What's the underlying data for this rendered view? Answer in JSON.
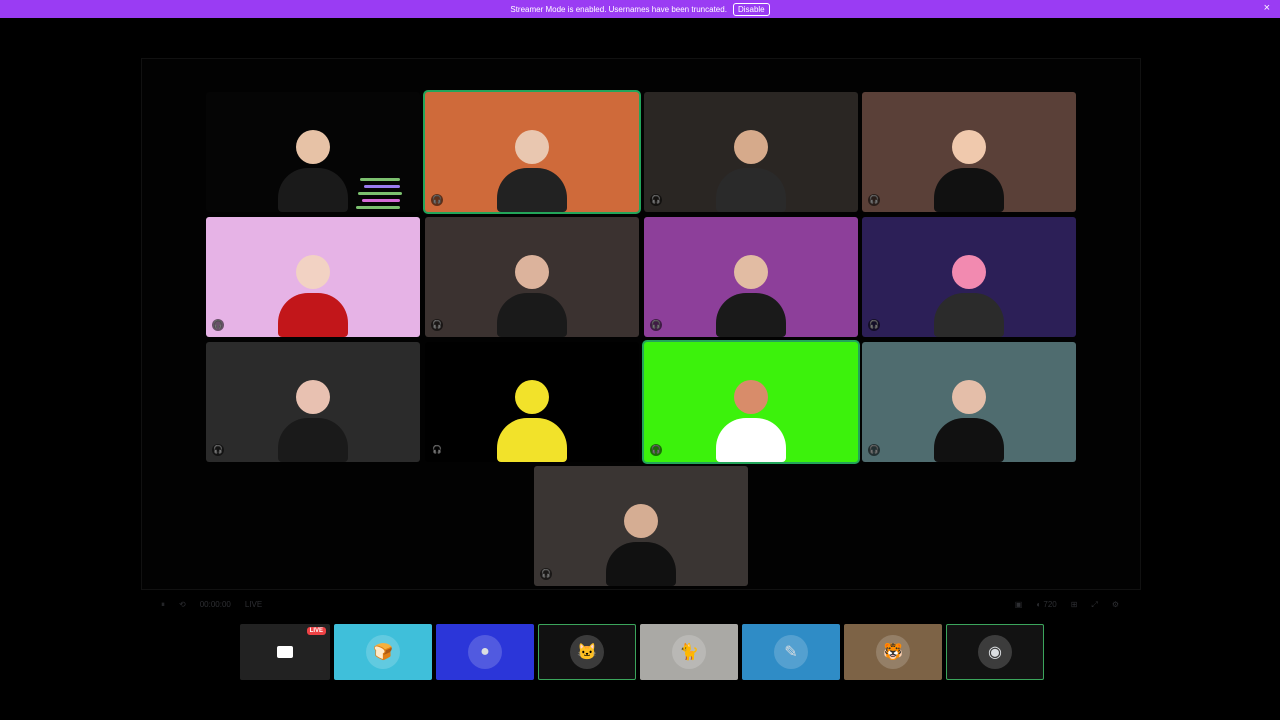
{
  "banner": {
    "message": "Streamer Mode is enabled. Usernames have been truncated.",
    "disable_label": "Disable",
    "close_icon": "×"
  },
  "tiles": [
    {
      "name": "tile-cam-boy",
      "bg": "#050505",
      "speaking": false
    },
    {
      "name": "tile-minecraft-glasses",
      "bg": "#cf6a3a",
      "speaking": true
    },
    {
      "name": "tile-cam-center",
      "bg": "#2a2623",
      "speaking": false
    },
    {
      "name": "tile-cam-bedroom",
      "bg": "#5a4038",
      "speaking": false
    },
    {
      "name": "tile-vtuber-pink",
      "bg": "#e6b3e6",
      "speaking": false
    },
    {
      "name": "tile-gaming-chair",
      "bg": "#3b3230",
      "speaking": false
    },
    {
      "name": "tile-purple-room",
      "bg": "#8d3f9a",
      "speaking": false
    },
    {
      "name": "tile-vtuber-catgirl",
      "bg": "#2c1f57",
      "speaking": false
    },
    {
      "name": "tile-purple-hair",
      "bg": "#2b2b2b",
      "speaking": false
    },
    {
      "name": "tile-chica-animatronic",
      "bg": "#000000",
      "speaking": false
    },
    {
      "name": "tile-greenscreen-vtuber",
      "bg": "#3cf20c",
      "speaking": true
    },
    {
      "name": "tile-plushies-room",
      "bg": "#4f6c6f",
      "speaking": false
    },
    {
      "name": "tile-cam-bottom",
      "bg": "#3a3533",
      "speaking": false
    }
  ],
  "strip": [
    {
      "name": "stream-preview",
      "bg": "#222",
      "icon": "▭",
      "live": "LIVE"
    },
    {
      "name": "participant-toast",
      "bg": "#3fbfda",
      "icon": "🍞"
    },
    {
      "name": "participant-blue-orb",
      "bg": "#2b36d9",
      "icon": "●"
    },
    {
      "name": "participant-purple-cat",
      "bg": "#111",
      "icon": "🐱",
      "active": true
    },
    {
      "name": "participant-cat-photo",
      "bg": "#aaa9a5",
      "icon": "🐈"
    },
    {
      "name": "participant-sketch-blue",
      "bg": "#2f8cc6",
      "icon": "✎"
    },
    {
      "name": "participant-glitch-cat",
      "bg": "#7d6346",
      "icon": "🐯"
    },
    {
      "name": "participant-green-avatar",
      "bg": "#121212",
      "icon": "◉",
      "active": true
    }
  ],
  "controls": {
    "left": [
      "⏸",
      "⟲",
      "00:00:00",
      "LIVE"
    ],
    "right": [
      "▣",
      "◐ 720",
      "⊞",
      "⤢",
      "⚙"
    ]
  }
}
